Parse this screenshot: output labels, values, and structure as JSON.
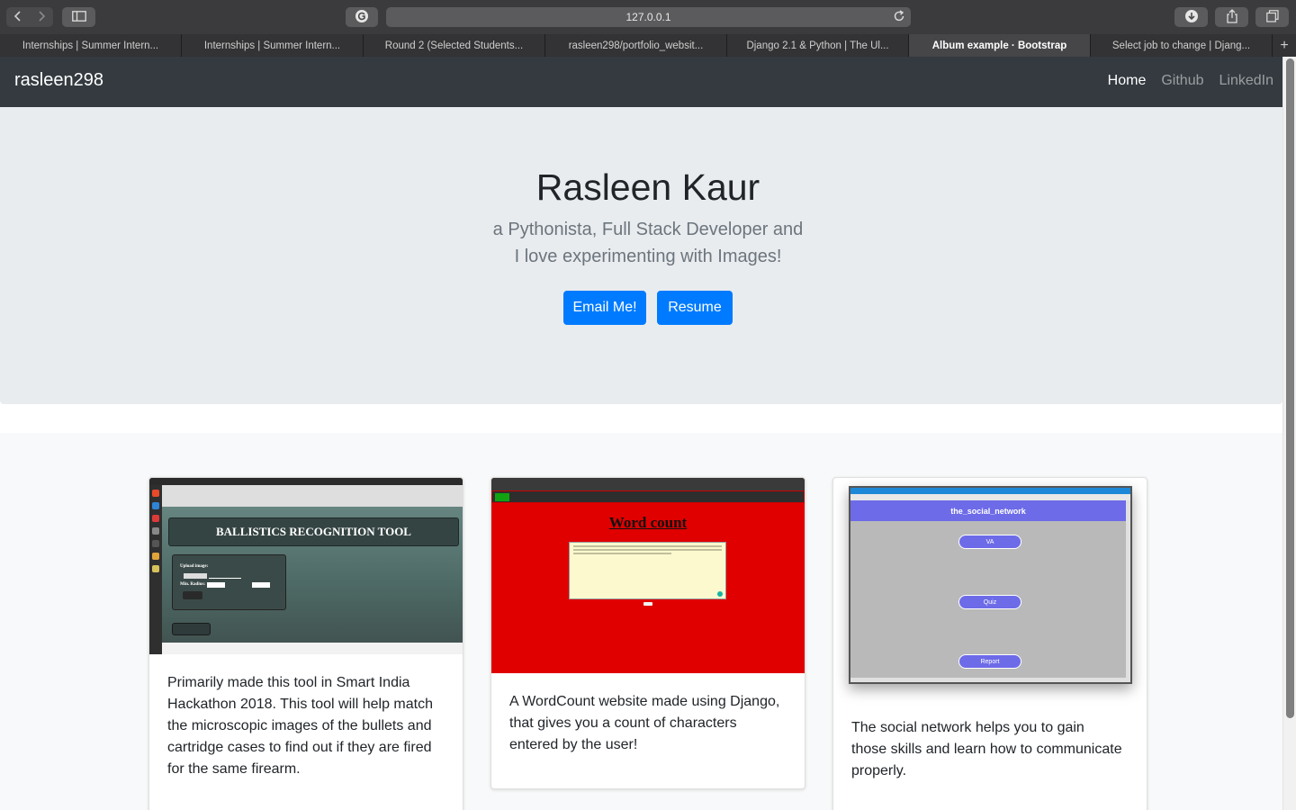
{
  "browser": {
    "url": "127.0.0.1",
    "tabs": [
      "Internships | Summer Intern...",
      "Internships | Summer Intern...",
      "Round 2 (Selected Students...",
      "rasleen298/portfolio_websit...",
      "Django 2.1 & Python | The Ul...",
      "Album example · Bootstrap",
      "Select job to change | Djang..."
    ],
    "active_tab": 5
  },
  "navbar": {
    "brand": "rasleen298",
    "links": [
      "Home",
      "Github",
      "LinkedIn"
    ],
    "active_link": "Home"
  },
  "hero": {
    "name": "Rasleen Kaur",
    "tagline_line1": "a Pythonista, Full Stack Developer and",
    "tagline_line2": "I love experimenting with Images!",
    "email_button": "Email Me!",
    "resume_button": "Resume"
  },
  "projects": [
    {
      "thumbnail_title": "BALLISTICS RECOGNITION TOOL",
      "description_lines": [
        "Primarily made this tool in Smart India",
        "Hackathon 2018. This tool will help match",
        "the microscopic images of the bullets and",
        "cartridge cases to find out if they are fired",
        "for the same firearm."
      ]
    },
    {
      "thumbnail_title": "Word count",
      "description_lines": [
        "A WordCount website made using Django,",
        "that gives you a count of characters",
        "entered by the user!"
      ]
    },
    {
      "thumbnail_title": "the_social_network",
      "thumbnail_buttons": [
        "VA",
        "Quiz",
        "Report"
      ],
      "description_lines": [
        "The social network helps you to gain",
        "those skills and learn how to communicate",
        "properly."
      ]
    }
  ],
  "colors": {
    "navbar_bg": "#343a40",
    "jumbotron_bg": "#e9ecef",
    "primary": "#007bff",
    "album_bg": "#f8f9fa"
  },
  "icons": [
    "back-arrow-icon",
    "forward-arrow-icon",
    "sidebar-icon",
    "grammarly-icon",
    "reload-icon",
    "download-icon",
    "share-icon",
    "tabs-overview-icon",
    "new-tab-plus-icon"
  ]
}
